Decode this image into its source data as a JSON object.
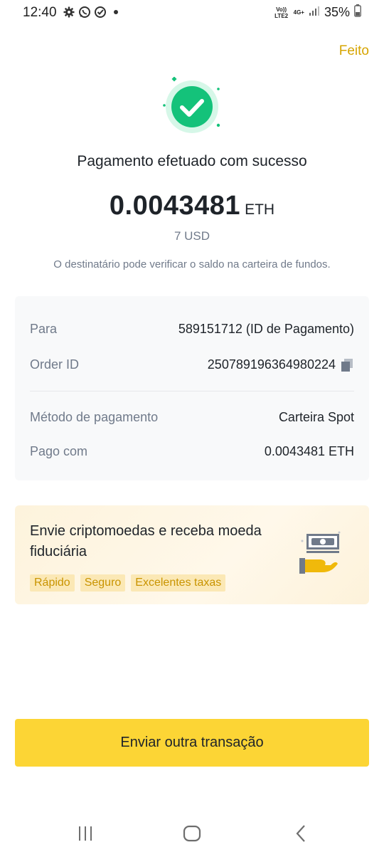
{
  "status_bar": {
    "time": "12:40",
    "net_top": "Vo)) LTE2",
    "net_4g": "4G+",
    "battery": "35%"
  },
  "header": {
    "done_label": "Feito"
  },
  "icons": {
    "success": "check-circle-icon",
    "copy": "copy-icon",
    "promo": "cash-hand-icon"
  },
  "result": {
    "title": "Pagamento efetuado com sucesso",
    "amount": "0.0043481",
    "currency": "ETH",
    "fiat": "7 USD",
    "note": "O destinatário pode verificar o saldo na carteira de fundos."
  },
  "details": {
    "to_label": "Para",
    "to_value": "589151712 (ID de Pagamento)",
    "order_label": "Order ID",
    "order_value": "250789196364980224",
    "method_label": "Método de pagamento",
    "method_value": "Carteira Spot",
    "paid_label": "Pago com",
    "paid_value": "0.0043481 ETH"
  },
  "promo": {
    "title": "Envie criptomoedas e receba moeda fiduciária",
    "tags": [
      "Rápido",
      "Seguro",
      "Excelentes taxas"
    ]
  },
  "actions": {
    "send_again": "Enviar outra transação"
  },
  "colors": {
    "accent": "#fcd535",
    "link": "#d6a400",
    "success": "#0ecb81",
    "muted": "#707a8a"
  }
}
